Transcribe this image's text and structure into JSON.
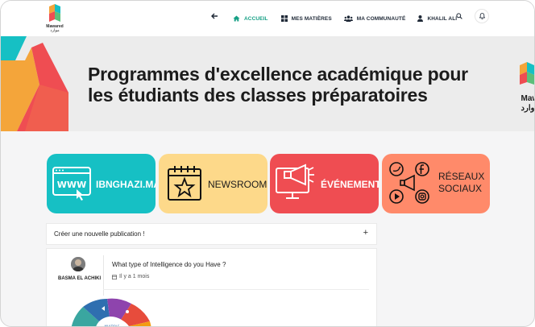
{
  "brand": {
    "name": "Mawared",
    "subtitle": "موارد",
    "colors": {
      "accent": "#16a085",
      "teal": "#16c0c4",
      "yellow": "#fdd98a",
      "red": "#ef4d52",
      "salmon": "#ff8a6a"
    }
  },
  "nav": {
    "back_icon": "arrow-left-icon",
    "items": [
      {
        "label": "ACCUEIL",
        "icon": "home-icon",
        "active": true
      },
      {
        "label": "MES MATIÈRES",
        "icon": "grid-icon",
        "active": false
      },
      {
        "label": "MA COMMUNAUTÉ",
        "icon": "users-icon",
        "active": false
      },
      {
        "label": "KHALIL ALI",
        "icon": "user-icon",
        "active": false
      }
    ],
    "search_icon": "search-icon",
    "bell_icon": "bell-icon"
  },
  "banner": {
    "title_line1": "Programmes d'excellence académique pour",
    "title_line2": "les étudiants des classes préparatoires",
    "brand_right_line1": "Maw",
    "brand_right_line2": "وارد–"
  },
  "tiles": [
    {
      "label": "IBNGHAZI.MA",
      "icon": "www-browser-icon",
      "color": "#16c0c4"
    },
    {
      "label": "NEWSROOM",
      "icon": "calendar-star-icon",
      "color": "#fdd98a"
    },
    {
      "label": "ÉVÉNEMENT",
      "icon": "megaphone-screen-icon",
      "color": "#ef4d52"
    },
    {
      "label_line1": "RÉSEAUX",
      "label_line2": "SOCIAUX",
      "icon": "social-networks-icon",
      "color": "#ff8a6a"
    }
  ],
  "create_post": {
    "label": "Créer une nouvelle publication !",
    "action": "+"
  },
  "post": {
    "author": "BASMA EL ACHIKI",
    "title": "What type of Intelligence do you Have ?",
    "time": "Il y a 1 mois"
  }
}
